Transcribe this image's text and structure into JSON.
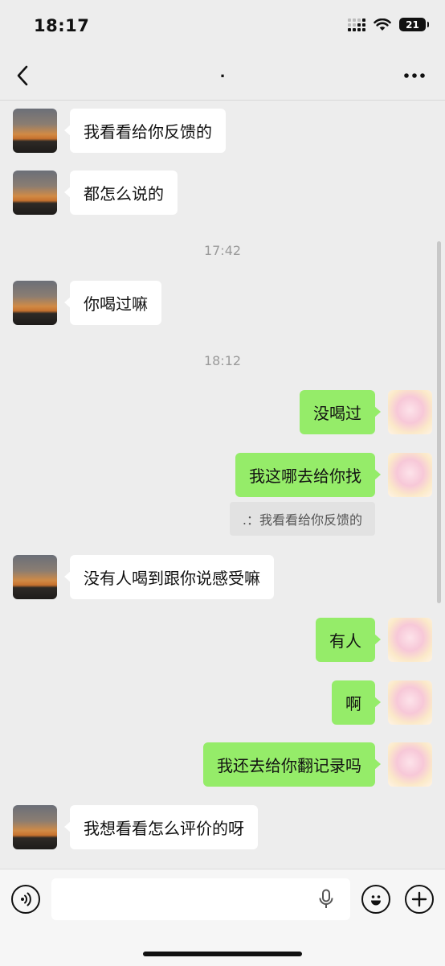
{
  "status_bar": {
    "time": "18:17",
    "battery": "21"
  },
  "nav": {
    "title": "."
  },
  "messages": [
    {
      "from": "contact",
      "text": "我看看给你反馈的"
    },
    {
      "from": "contact",
      "text": "都怎么说的"
    },
    {
      "type": "time",
      "text": "17:42"
    },
    {
      "from": "contact",
      "text": "你喝过嘛"
    },
    {
      "type": "time",
      "text": "18:12"
    },
    {
      "from": "me",
      "text": "没喝过"
    },
    {
      "from": "me",
      "text": "我这哪去给你找",
      "quote": ".：我看看给你反馈的"
    },
    {
      "from": "contact",
      "text": "没有人喝到跟你说感受嘛"
    },
    {
      "from": "me",
      "text": "有人"
    },
    {
      "from": "me",
      "text": "啊"
    },
    {
      "from": "me",
      "text": "我还去给你翻记录吗"
    },
    {
      "from": "contact",
      "text": "我想看看怎么评价的呀"
    }
  ],
  "icons": {
    "back": "chevron-left-icon",
    "more": "more-dots-icon",
    "voice": "voice-icon",
    "mic": "microphone-icon",
    "emoji": "emoji-icon",
    "add": "plus-icon"
  },
  "colors": {
    "self_bubble": "#95ec69",
    "contact_bubble": "#ffffff",
    "background": "#ededed"
  }
}
